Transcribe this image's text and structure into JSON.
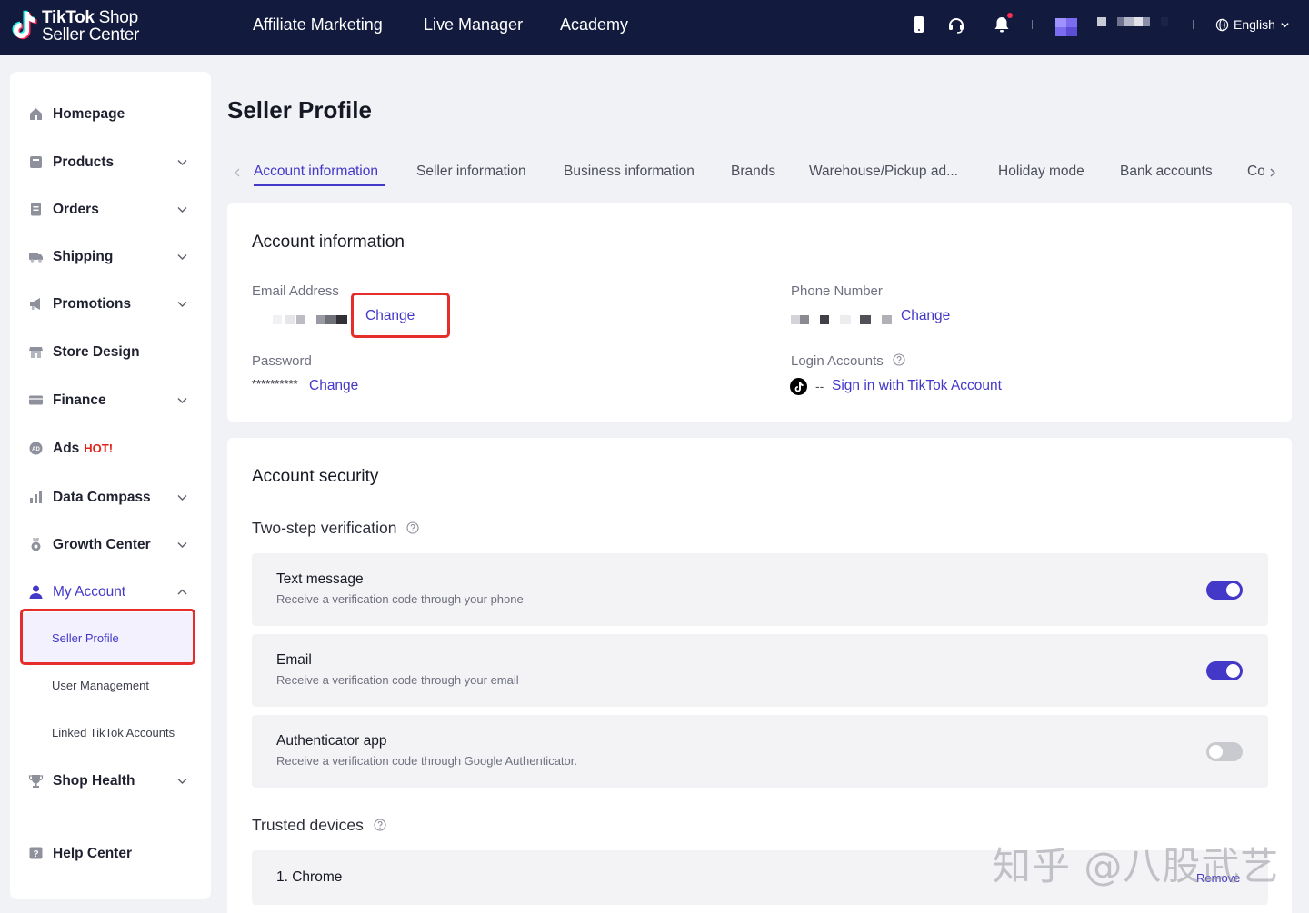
{
  "brand": {
    "line1_bold": "TikTok",
    "line1_rest": " Shop",
    "line2": "Seller Center"
  },
  "topnav": {
    "affiliate": "Affiliate Marketing",
    "live": "Live Manager",
    "academy": "Academy"
  },
  "topicons": [
    "phone-icon",
    "headset-icon",
    "bell-icon"
  ],
  "language": "English",
  "colors": {
    "topbar": "#121a3e",
    "accent": "#4438c8",
    "highlight": "#e52e2a",
    "hot": "#e0241f"
  },
  "sidebar": {
    "items": [
      {
        "label": "Homepage",
        "icon": "home-icon",
        "chevron": false
      },
      {
        "label": "Products",
        "icon": "products-icon",
        "chevron": true
      },
      {
        "label": "Orders",
        "icon": "orders-icon",
        "chevron": true
      },
      {
        "label": "Shipping",
        "icon": "truck-icon",
        "chevron": true
      },
      {
        "label": "Promotions",
        "icon": "megaphone-icon",
        "chevron": true
      },
      {
        "label": "Store Design",
        "icon": "store-icon",
        "chevron": false
      },
      {
        "label": "Finance",
        "icon": "card-icon",
        "chevron": true
      },
      {
        "label": "Ads",
        "icon": "ads-icon",
        "chevron": false,
        "badge": "HOT!"
      },
      {
        "label": "Data Compass",
        "icon": "chart-icon",
        "chevron": true
      },
      {
        "label": "Growth Center",
        "icon": "medal-icon",
        "chevron": true
      },
      {
        "label": "My Account",
        "icon": "user-icon",
        "chevron": true,
        "expanded": true
      },
      {
        "label": "Shop Health",
        "icon": "trophy-icon",
        "chevron": true
      },
      {
        "label": "Help Center",
        "icon": "help-icon",
        "chevron": false
      }
    ],
    "sub_items": [
      "Seller Profile",
      "User Management",
      "Linked TikTok Accounts"
    ]
  },
  "page": {
    "title": "Seller Profile"
  },
  "tabs": [
    "Account information",
    "Seller information",
    "Business information",
    "Brands",
    "Warehouse/Pickup ad...",
    "Holiday mode",
    "Bank accounts",
    "Co"
  ],
  "account_info": {
    "title": "Account information",
    "email_label": "Email Address",
    "phone_label": "Phone Number",
    "password_label": "Password",
    "password_value": "**********",
    "login_label": "Login Accounts",
    "login_value": "--",
    "sign_in_link": "Sign in with TikTok Account",
    "change": "Change"
  },
  "security": {
    "title": "Account security",
    "two_step": "Two-step verification",
    "rows": [
      {
        "title": "Text message",
        "desc": "Receive a verification code through your phone",
        "enabled": true
      },
      {
        "title": "Email",
        "desc": "Receive a verification code through your email",
        "enabled": true
      },
      {
        "title": "Authenticator app",
        "desc": "Receive a verification code through Google Authenticator.",
        "enabled": false
      }
    ],
    "trusted": "Trusted devices",
    "device": "1. Chrome",
    "remove": "Remove"
  },
  "watermark": "知乎 @八股武艺"
}
